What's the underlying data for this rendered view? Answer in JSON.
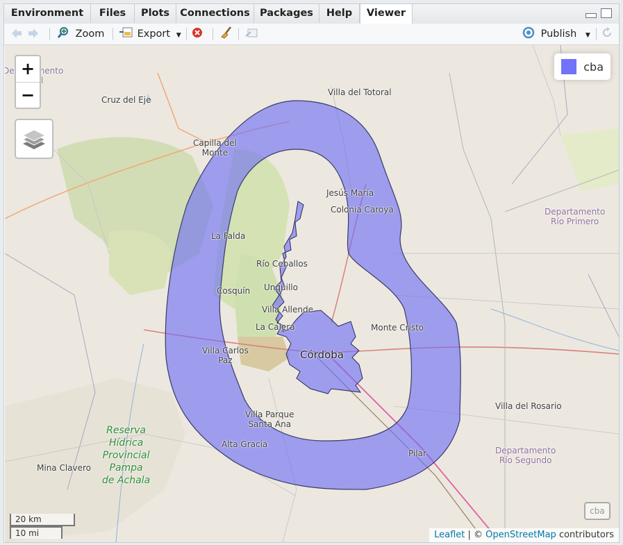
{
  "tabs": [
    "Environment",
    "Files",
    "Plots",
    "Connections",
    "Packages",
    "Help",
    "Viewer"
  ],
  "active_tab": "Viewer",
  "toolbar": {
    "zoom_label": "Zoom",
    "export_label": "Export",
    "publish_label": "Publish"
  },
  "map": {
    "zoom_in": "+",
    "zoom_out": "−",
    "legend_label": "cba",
    "legend_color": "#7272fa",
    "mini_legend": "cba",
    "scale_km": "20 km",
    "scale_mi": "10 mi",
    "attribution": {
      "leaflet": "Leaflet",
      "sep": " | © ",
      "osm": "OpenStreetMap",
      "suffix": " contributors"
    },
    "places": {
      "dep_topleft_1": "Departamento",
      "dep_topleft_2": "del",
      "cruz_del_eje": "Cruz del Eje",
      "villa_del_totoral": "Villa del Totoral",
      "capilla_1": "Capilla del",
      "capilla_2": "Monte",
      "jesus_maria": "Jesús María",
      "colonia_caroya": "Colonia Caroya",
      "dep_rio_primero_1": "Departamento",
      "dep_rio_primero_2": "Río Primero",
      "la_falda": "La Falda",
      "rio_ceballos": "Río Ceballos",
      "cosquin": "Cosquín",
      "unquillo": "Unquillo",
      "villa_allende": "Villa Allende",
      "la_calera": "La Calera",
      "monte_cristo": "Monte Cristo",
      "villa_carlos_paz_1": "Villa Carlos",
      "villa_carlos_paz_2": "Paz",
      "cordoba": "Córdoba",
      "villa_del_rosario": "Villa del Rosario",
      "villa_parque_1": "Villa Parque",
      "villa_parque_2": "Santa Ana",
      "alta_gracia": "Alta Gracia",
      "pilar": "Pilar",
      "dep_rio_segundo_1": "Departamento",
      "dep_rio_segundo_2": "Río Segundo",
      "reserva_1": "Reserva",
      "reserva_2": "Hídrica",
      "reserva_3": "Provincial",
      "reserva_4": "Pampa",
      "reserva_5": "de Achala",
      "mina_clavero": "Mina Clavero"
    }
  }
}
